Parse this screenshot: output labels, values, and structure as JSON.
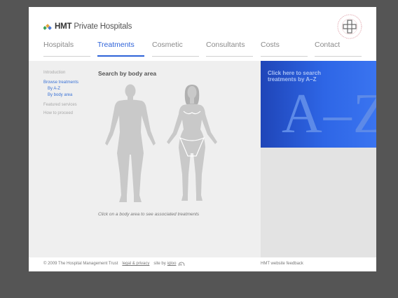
{
  "header": {
    "logo_bold": "HMT",
    "logo_rest": "Private Hospitals",
    "seal_icon": "hospital-cross-seal-icon",
    "brand_colors": [
      "#3aa35a",
      "#e8a43a",
      "#4a78d6"
    ]
  },
  "nav": {
    "items": [
      {
        "label": "Hospitals"
      },
      {
        "label": "Treatments",
        "active": true
      },
      {
        "label": "Cosmetic"
      },
      {
        "label": "Consultants"
      },
      {
        "label": "Costs"
      },
      {
        "label": "Contact"
      }
    ],
    "accent_color": "#2d62d8"
  },
  "sidebar": {
    "introduction": "Introduction",
    "browse": "Browse treatments",
    "az": "By A-Z",
    "body_area": "By body area",
    "featured": "Featured services",
    "how": "How to proceed"
  },
  "main": {
    "title": "Search by body area",
    "caption": "Click on a body area to see associated treatments",
    "figure_male_icon": "male-body-figure-icon",
    "figure_female_icon": "female-body-figure-icon"
  },
  "promo": {
    "text": "Click here to search treatments by A–Z",
    "big": "A–Z"
  },
  "footer": {
    "copyright": "© 2009 The Hospital Management Trust",
    "legal": "legal & privacy",
    "site_by": "site by",
    "agency": "igloo",
    "feedback": "HMT website feedback"
  }
}
